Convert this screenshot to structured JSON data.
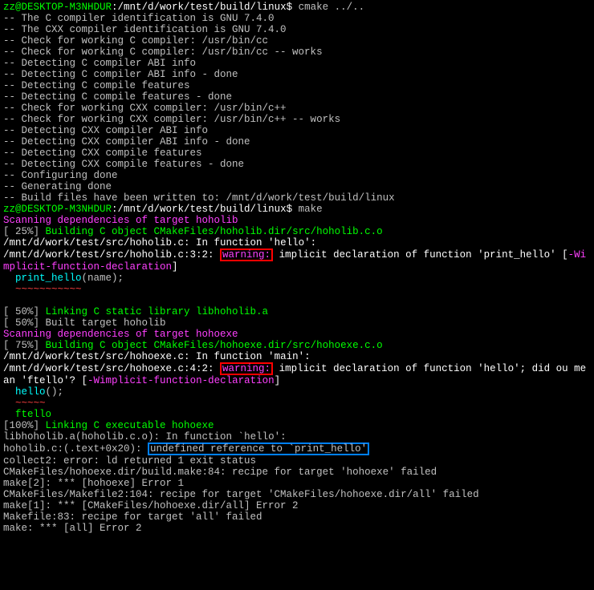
{
  "prompt1_user": "zz@DESKTOP-M3NHDUR",
  "prompt1_path": ":/mnt/d/work/test/build/linux$ ",
  "cmd1": "cmake ../..",
  "cmake": {
    "l1": "-- The C compiler identification is GNU 7.4.0",
    "l2": "-- The CXX compiler identification is GNU 7.4.0",
    "l3": "-- Check for working C compiler: /usr/bin/cc",
    "l4": "-- Check for working C compiler: /usr/bin/cc -- works",
    "l5": "-- Detecting C compiler ABI info",
    "l6": "-- Detecting C compiler ABI info - done",
    "l7": "-- Detecting C compile features",
    "l8": "-- Detecting C compile features - done",
    "l9": "-- Check for working CXX compiler: /usr/bin/c++",
    "l10": "-- Check for working CXX compiler: /usr/bin/c++ -- works",
    "l11": "-- Detecting CXX compiler ABI info",
    "l12": "-- Detecting CXX compiler ABI info - done",
    "l13": "-- Detecting CXX compile features",
    "l14": "-- Detecting CXX compile features - done",
    "l15": "-- Configuring done",
    "l16": "-- Generating done",
    "l17": "-- Build files have been written to: /mnt/d/work/test/build/linux"
  },
  "prompt2_user": "zz@DESKTOP-M3NHDUR",
  "prompt2_path": ":/mnt/d/work/test/build/linux$ ",
  "cmd2": "make",
  "scan1": "Scanning dependencies of target hoholib",
  "p25": "[ 25%] ",
  "build_c1": "Building C object CMakeFiles/hoholib.dir/src/hoholib.c.o",
  "func_hello_pre": "/mnt/d/work/test/src/hoholib.c: In function '",
  "func_hello_name": "hello",
  "func_hello_post": "':",
  "warn1_loc": "/mnt/d/work/test/src/hoholib.c:3:2: ",
  "warn1_tag": "warning:",
  "warn1_msg": " implicit declaration of function '",
  "warn1_fn": "print_hello",
  "warn1_end": "' ",
  "wimp_open": "[",
  "wimp_flag": "-Wimplicit-function-declaration",
  "wimp_close": "]",
  "code1_pre": "  ",
  "code1_call": "print_hello",
  "code1_args": "(name);",
  "code1_tilde": "  ~~~~~~~~~~~",
  "p50a": "[ 50%] ",
  "link1": "Linking C static library libhoholib.a",
  "p50b": "[ 50%] Built target hoholib",
  "scan2": "Scanning dependencies of target hohoexe",
  "p75": "[ 75%] ",
  "build_c2": "Building C object CMakeFiles/hohoexe.dir/src/hohoexe.c.o",
  "func_main_pre": "/mnt/d/work/test/src/hohoexe.c: In function '",
  "func_main_name": "main",
  "func_main_post": "':",
  "warn2_loc": "/mnt/d/work/test/src/hohoexe.c:4:2: ",
  "warn2_tag": "warning:",
  "warn2_msg": " implicit declaration of function '",
  "warn2_fn": "hello",
  "warn2_mid": "'; did ou mean '",
  "warn2_suggest": "ftello",
  "warn2_end": "'? [",
  "warn2_flag": "-Wimplicit-function-declaration",
  "warn2_close": "]",
  "code2_pre": "  ",
  "code2_call": "hello",
  "code2_args": "();",
  "code2_tilde": "  ~~~~~",
  "suggest2": "  ftello",
  "p100": "[100%] ",
  "link2": "Linking C executable hohoexe",
  "err_loc": "libhoholib.a(hoholib.c.o): In function `",
  "err_fn": "hello",
  "err_post": "':",
  "err2_loc": "hoholib.c:(.text+0x20): ",
  "err2_msg": "undefined reference to `print_hello'",
  "collect": "collect2: error: ld returned 1 exit status",
  "mk1": "CMakeFiles/hohoexe.dir/build.make:84: recipe for target 'hohoexe' failed",
  "mk2": "make[2]: *** [hohoexe] Error 1",
  "mk3": "CMakeFiles/Makefile2:104: recipe for target 'CMakeFiles/hohoexe.dir/all' failed",
  "mk4": "make[1]: *** [CMakeFiles/hohoexe.dir/all] Error 2",
  "mk5": "Makefile:83: recipe for target 'all' failed",
  "mk6": "make: *** [all] Error 2"
}
